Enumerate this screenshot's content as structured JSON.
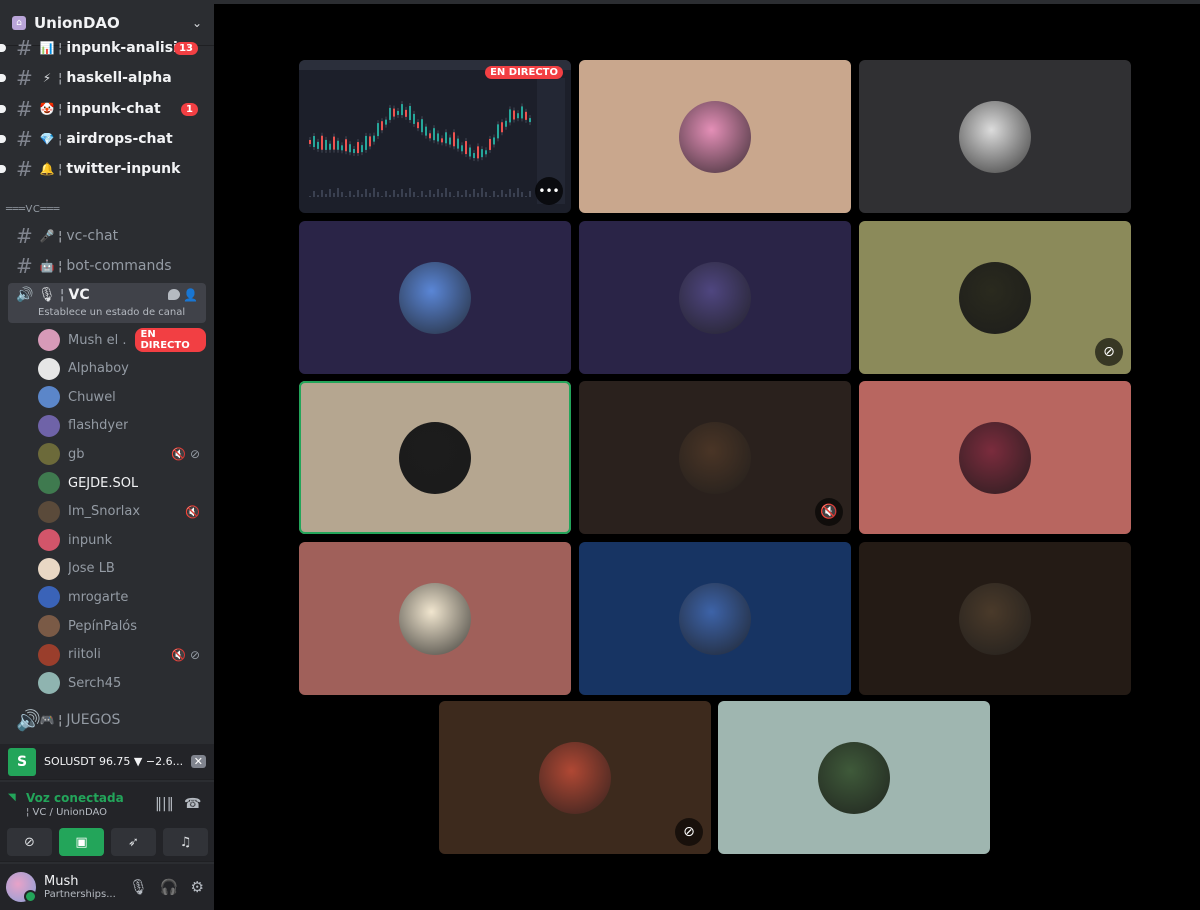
{
  "server": {
    "name": "UnionDAO"
  },
  "channels": [
    {
      "emoji": "📊",
      "name": "inpunk-analisis",
      "badge": "13",
      "unread": true
    },
    {
      "emoji": "⚡",
      "name": "haskell-alpha",
      "badge": "",
      "unread": true
    },
    {
      "emoji": "🤡",
      "name": "inpunk-chat",
      "badge": "1",
      "unread": true
    },
    {
      "emoji": "💎",
      "name": "airdrops-chat",
      "badge": "",
      "unread": true
    },
    {
      "emoji": "🔔",
      "name": "twitter-inpunk",
      "badge": "",
      "unread": true
    }
  ],
  "vc_category": "═══VC═══",
  "vc_channels": [
    {
      "emoji": "🎤",
      "name": "vc-chat"
    },
    {
      "emoji": "🤖",
      "name": "bot-commands"
    }
  ],
  "active_vc": {
    "emoji": "🎙",
    "name": "VC",
    "status": "Establece un estado de canal"
  },
  "voice_users": [
    {
      "name": "Mush el ...",
      "live": "EN DIRECTO",
      "color": "#d79ab8",
      "indicator": ""
    },
    {
      "name": "Alphaboy",
      "live": "",
      "color": "#e6e6e6",
      "indicator": ""
    },
    {
      "name": "Chuwel",
      "live": "",
      "color": "#5b86c9",
      "indicator": ""
    },
    {
      "name": "flashdyer",
      "live": "",
      "color": "#6f63a8",
      "indicator": ""
    },
    {
      "name": "gb",
      "live": "",
      "color": "#6c6a3a",
      "indicator": "🔇 ⊘"
    },
    {
      "name": "GEJDE.SOL",
      "live": "",
      "color": "#3f7a4f",
      "indicator": "",
      "bright": true
    },
    {
      "name": "Im_Snorlax",
      "live": "",
      "color": "#5a4a3a",
      "indicator": "🔇"
    },
    {
      "name": "inpunk",
      "live": "",
      "color": "#d2556a",
      "indicator": ""
    },
    {
      "name": "Jose LB",
      "live": "",
      "color": "#e8d7c4",
      "indicator": ""
    },
    {
      "name": "mrogarte",
      "live": "",
      "color": "#3a63b8",
      "indicator": ""
    },
    {
      "name": "PepínPalós",
      "live": "",
      "color": "#7a5a46",
      "indicator": ""
    },
    {
      "name": "riitoli",
      "live": "",
      "color": "#9a3e2c",
      "indicator": "🔇 ⊘"
    },
    {
      "name": "Serch45",
      "live": "",
      "color": "#8fb4b0",
      "indicator": ""
    }
  ],
  "games_channel": {
    "emoji": "🎮",
    "name": "JUEGOS"
  },
  "activity": {
    "icon_letter": "S",
    "text": "SOLUSDT 96.75 ▼ −2.6..."
  },
  "voice_panel": {
    "status": "Voz conectada",
    "where": "¦ VC / UnionDAO"
  },
  "user": {
    "name": "Mush",
    "sub": "Partnerships..."
  },
  "stage_tiles": [
    {
      "kind": "share",
      "live": "EN DIRECTO",
      "more": "•••"
    },
    {
      "bg": "#c9a78d",
      "av": "#e48fb7",
      "ind": ""
    },
    {
      "bg": "#303033",
      "av": "#dcdcdc",
      "ind": ""
    },
    {
      "bg": "#2a2447",
      "av": "#5a86d6",
      "ind": ""
    },
    {
      "bg": "#2a2447",
      "av": "#4f4680",
      "ind": ""
    },
    {
      "bg": "#8b8a5a",
      "av": "#2a2a1e",
      "ind": "⊘"
    },
    {
      "bg": "#b5a690",
      "av": "#1c1c1c",
      "ind": "",
      "speaking": true
    },
    {
      "bg": "#2a211d",
      "av": "#4a3526",
      "ind": "🔇"
    },
    {
      "bg": "#b86660",
      "av": "#7b2c3d",
      "ind": ""
    },
    {
      "bg": "#a0605a",
      "av": "#f1e6cf",
      "ind": ""
    },
    {
      "bg": "#173463",
      "av": "#3d63a8",
      "ind": ""
    },
    {
      "bg": "#241b15",
      "av": "#4a3a2a",
      "ind": ""
    },
    {
      "bg": "#3d2a1d",
      "av": "#b04834",
      "ind": "⊘"
    },
    {
      "bg": "#9fb6b0",
      "av": "#3f5a3a",
      "ind": ""
    }
  ]
}
